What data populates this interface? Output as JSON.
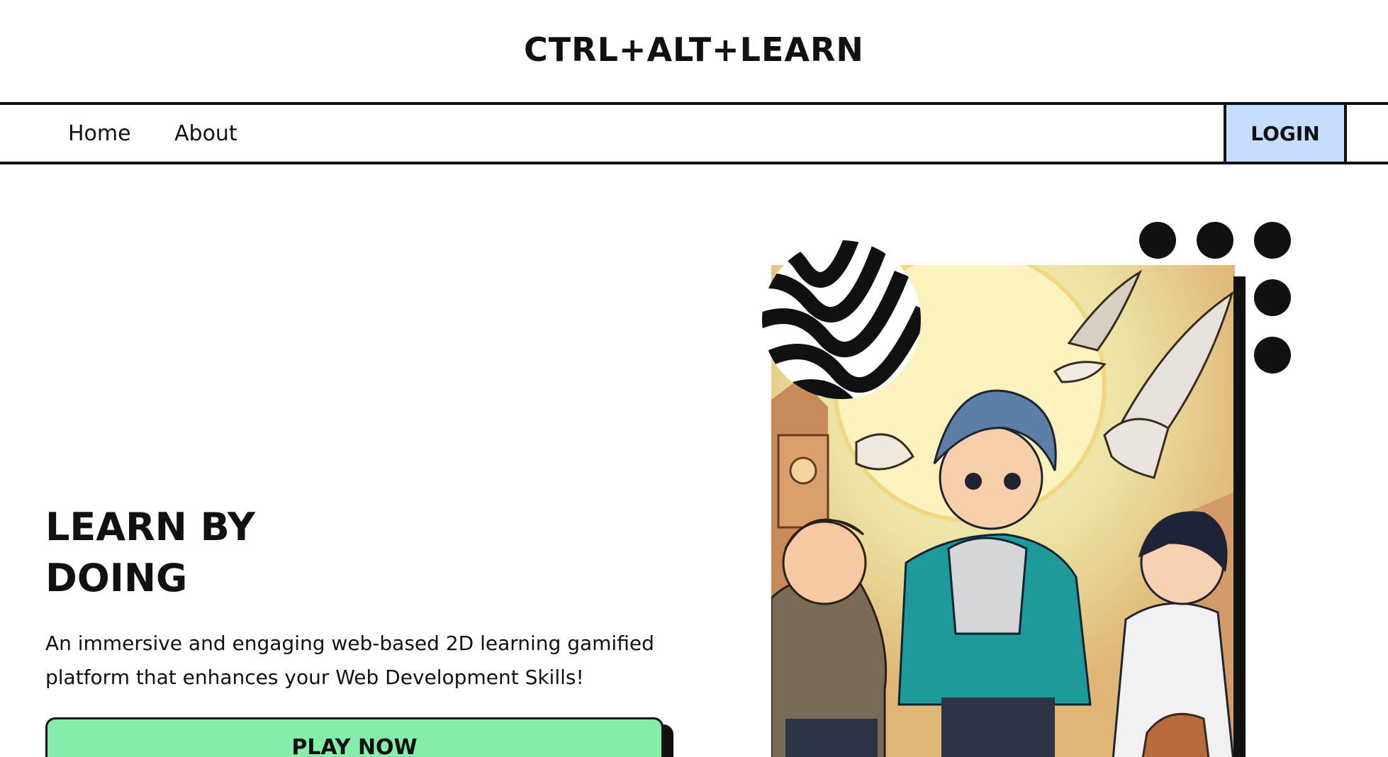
{
  "header": {
    "title": "CTRL+ALT+LEARN"
  },
  "nav": {
    "links": [
      "Home",
      "About"
    ],
    "login_label": "LOGIN"
  },
  "hero": {
    "heading_line1": "LEARN BY",
    "heading_line2": "DOING",
    "description": "An immersive and engaging web-based 2D learning gamified platform that enhances your Web Development Skills!",
    "cta_label": "PLAY NOW"
  },
  "colors": {
    "login_bg": "#c5deff",
    "cta_bg": "#86ecaa",
    "ink": "#111111"
  }
}
